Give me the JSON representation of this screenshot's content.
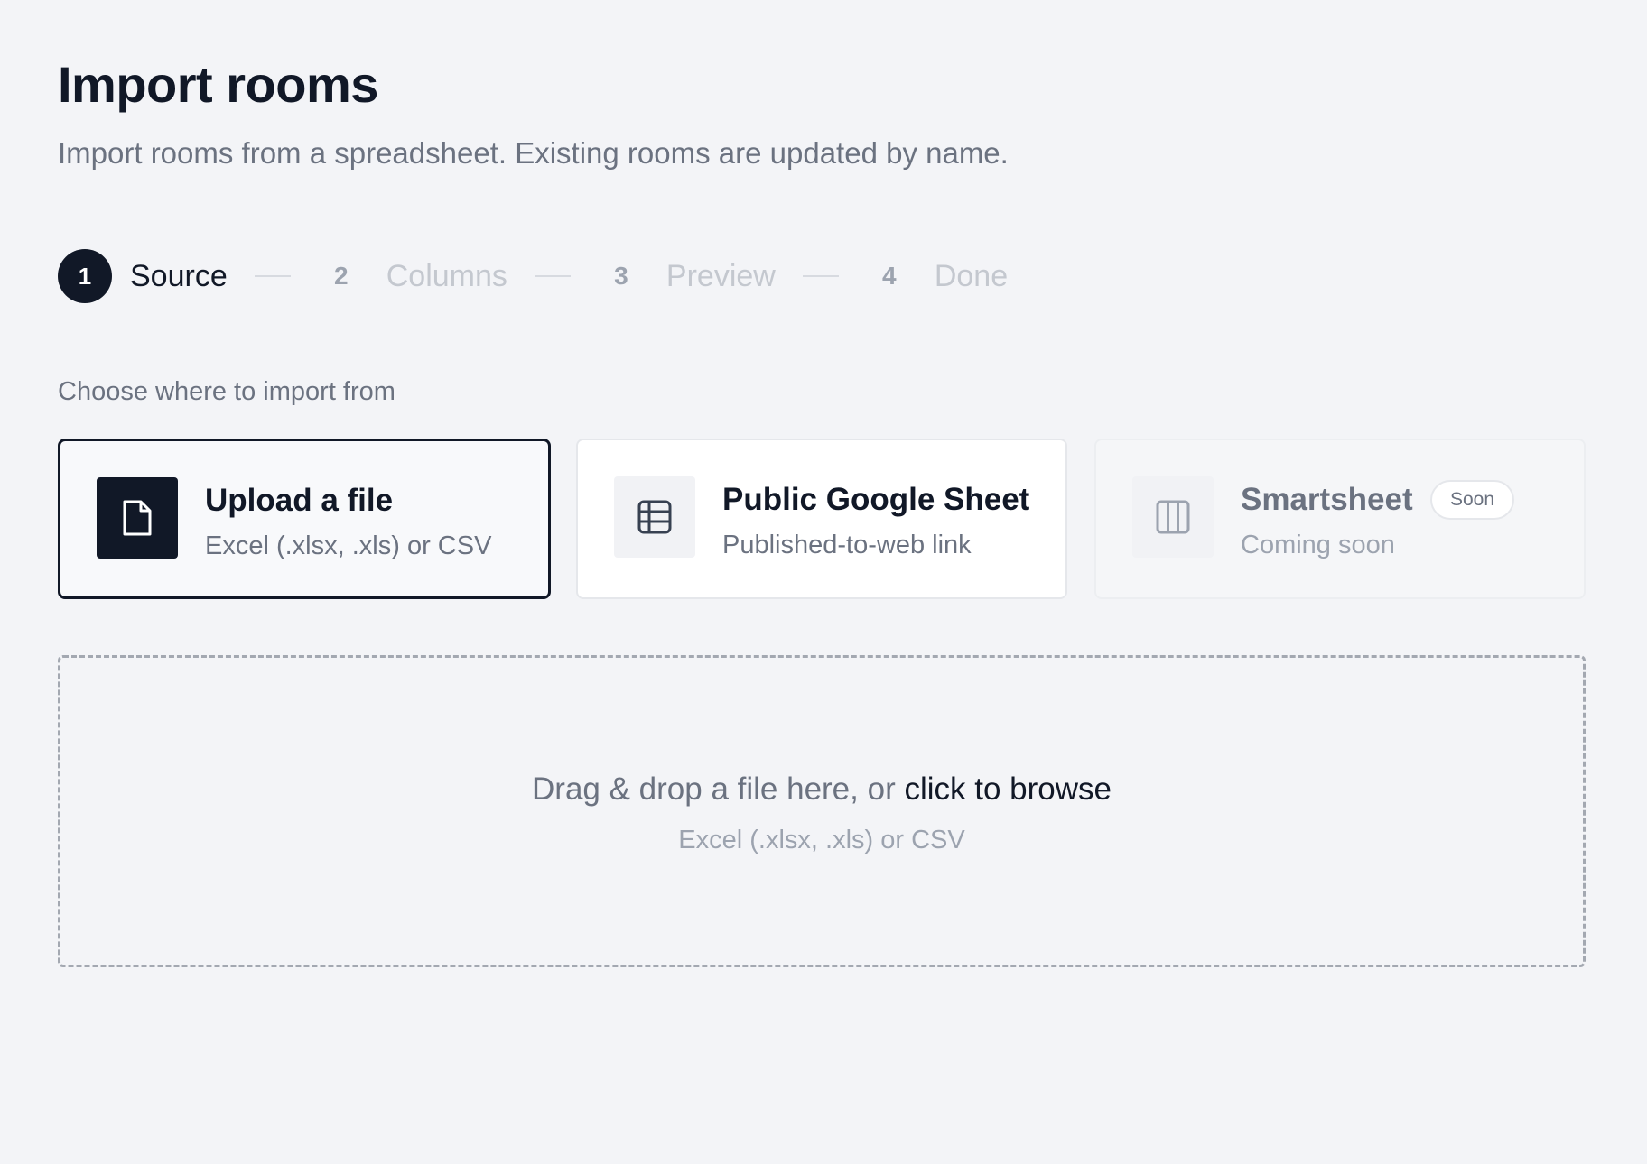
{
  "header": {
    "title": "Import rooms",
    "subtitle": "Import rooms from a spreadsheet. Existing rooms are updated by name."
  },
  "stepper": {
    "steps": [
      {
        "number": "1",
        "label": "Source",
        "state": "active"
      },
      {
        "number": "2",
        "label": "Columns",
        "state": "inactive"
      },
      {
        "number": "3",
        "label": "Preview",
        "state": "inactive"
      },
      {
        "number": "4",
        "label": "Done",
        "state": "inactive"
      }
    ]
  },
  "source": {
    "label": "Choose where to import from",
    "options": [
      {
        "title": "Upload a file",
        "description": "Excel (.xlsx, .xls) or CSV",
        "icon": "file-icon",
        "selected": true
      },
      {
        "title": "Public Google Sheet",
        "description": "Published-to-web link",
        "icon": "table-icon",
        "selected": false
      },
      {
        "title": "Smartsheet",
        "description": "Coming soon",
        "icon": "columns-icon",
        "badge": "Soon",
        "disabled": true
      }
    ]
  },
  "dropzone": {
    "prompt": "Drag & drop a file here, or ",
    "browse_link": "click to browse",
    "hint": "Excel (.xlsx, .xls) or CSV"
  },
  "colors": {
    "primary": "#111827",
    "muted_text": "#6b7280",
    "background": "#f3f4f7"
  }
}
